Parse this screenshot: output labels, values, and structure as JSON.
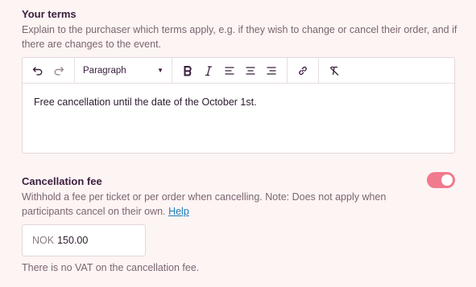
{
  "terms": {
    "title": "Your terms",
    "description": "Explain to the purchaser which terms apply, e.g. if they wish to change or cancel their order, and if there are changes to the event.",
    "toolbar": {
      "undo_icon": "undo-icon",
      "redo_icon": "redo-icon",
      "block_format": "Paragraph",
      "buttons": [
        "bold-icon",
        "italic-icon",
        "align-left-icon",
        "align-center-icon",
        "align-right-icon",
        "link-icon",
        "clear-format-icon"
      ]
    },
    "content": "Free cancellation until the date of the October 1st."
  },
  "cancellation_fee": {
    "title": "Cancellation fee",
    "toggle_on": true,
    "description": "Withhold a fee per ticket or per order when cancelling. Note: Does not apply when participants cancel on their own.",
    "help_label": "Help",
    "currency": "NOK",
    "amount": "150.00",
    "vat_note": "There is no VAT on the cancellation fee."
  },
  "colors": {
    "background": "#fdf4f4",
    "toggle": "#f07a8e",
    "link": "#1f7db8",
    "heading": "#3a1d3d"
  }
}
